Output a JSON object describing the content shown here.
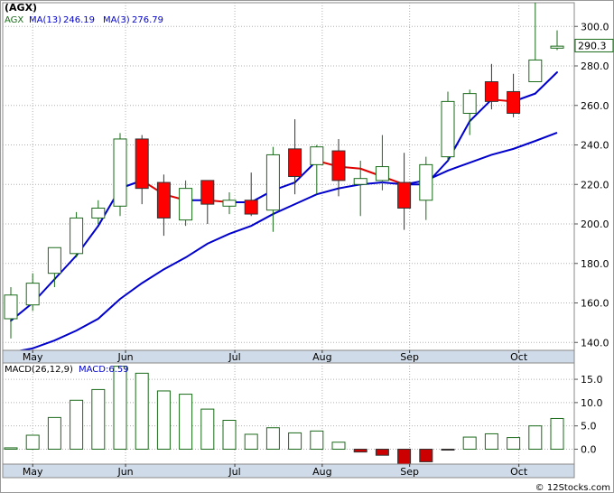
{
  "header": {
    "symbol": "(AGX)",
    "legend_ticker": "AGX",
    "ma_long_label": "MA(13)",
    "ma_long_value": "246.19",
    "ma_short_label": "MA(3)",
    "ma_short_value": "276.79",
    "last_price_tag": "290.3"
  },
  "macd_header": {
    "label": "MACD(26,12,9)",
    "value_label": "MACD:6.59"
  },
  "watermark": "© 12Stocks.com",
  "colors": {
    "background": "#ffffff",
    "panel_bg": "#ffffff",
    "grid": "#b0b0b0",
    "axis_band": "#cfdbe8",
    "up_candle_fill": "#ffffff",
    "up_candle_stroke": "#1a6b1a",
    "down_candle_fill": "#ff0000",
    "down_candle_stroke": "#333333",
    "ma_long": "#0000cc",
    "ma_short_up": "#0000cc",
    "ma_short_down": "#e00000",
    "legend_ticker": "#1a6b1a",
    "legend_ma": "#0000cc",
    "macd_pos_stroke": "#1a6b1a",
    "macd_neg_fill": "#cc0000"
  },
  "chart_data": {
    "type": "candlestick",
    "period": "weekly",
    "x_labels": [
      {
        "label": "May",
        "index": 1
      },
      {
        "label": "Jun",
        "index": 5.25
      },
      {
        "label": "Jul",
        "index": 10.25
      },
      {
        "label": "Aug",
        "index": 14.25
      },
      {
        "label": "Sep",
        "index": 18.25
      },
      {
        "label": "Oct",
        "index": 23.25
      }
    ],
    "price_axis": {
      "ylim": [
        136,
        312
      ],
      "ticks": [
        140,
        160,
        180,
        200,
        220,
        240,
        260,
        280,
        300
      ],
      "tick_labels": [
        "140.0",
        "160.0",
        "180.0",
        "200.0",
        "220.0",
        "240.0",
        "260.0",
        "280.0",
        "300.0"
      ],
      "last_price": 290.3
    },
    "candles": [
      {
        "o": 152,
        "h": 168,
        "l": 142,
        "c": 164
      },
      {
        "o": 159,
        "h": 175,
        "l": 156,
        "c": 170
      },
      {
        "o": 175,
        "h": 188,
        "l": 168,
        "c": 188
      },
      {
        "o": 185,
        "h": 206,
        "l": 183,
        "c": 203
      },
      {
        "o": 203,
        "h": 212,
        "l": 200,
        "c": 208
      },
      {
        "o": 209,
        "h": 246,
        "l": 204,
        "c": 243
      },
      {
        "o": 243,
        "h": 245,
        "l": 210,
        "c": 218
      },
      {
        "o": 221,
        "h": 225,
        "l": 194,
        "c": 203
      },
      {
        "o": 202,
        "h": 222,
        "l": 199,
        "c": 218
      },
      {
        "o": 222,
        "h": 222,
        "l": 200,
        "c": 210
      },
      {
        "o": 209,
        "h": 216,
        "l": 205,
        "c": 212
      },
      {
        "o": 212,
        "h": 226,
        "l": 204,
        "c": 205
      },
      {
        "o": 207,
        "h": 239,
        "l": 196,
        "c": 235
      },
      {
        "o": 238,
        "h": 253,
        "l": 215,
        "c": 224
      },
      {
        "o": 230,
        "h": 240,
        "l": 215,
        "c": 239
      },
      {
        "o": 237,
        "h": 243,
        "l": 214,
        "c": 222
      },
      {
        "o": 220,
        "h": 232,
        "l": 204,
        "c": 223
      },
      {
        "o": 222,
        "h": 245,
        "l": 217,
        "c": 229
      },
      {
        "o": 221,
        "h": 236,
        "l": 197,
        "c": 208
      },
      {
        "o": 212,
        "h": 234,
        "l": 202,
        "c": 230
      },
      {
        "o": 234,
        "h": 267,
        "l": 232,
        "c": 262
      },
      {
        "o": 256,
        "h": 268,
        "l": 245,
        "c": 266
      },
      {
        "o": 272,
        "h": 281,
        "l": 258,
        "c": 262
      },
      {
        "o": 267,
        "h": 276,
        "l": 254,
        "c": 256
      },
      {
        "o": 272,
        "h": 312,
        "l": 272,
        "c": 283
      },
      {
        "o": 289,
        "h": 298,
        "l": 288,
        "c": 290
      }
    ],
    "series": [
      {
        "name": "MA(13)",
        "values": [
          null,
          null,
          null,
          null,
          null,
          null,
          null,
          null,
          null,
          null,
          null,
          null,
          null,
          null,
          null,
          null,
          null,
          null,
          null,
          null,
          null,
          null,
          null,
          null,
          null,
          null
        ]
      }
    ],
    "ma_long": [
      135,
      137,
      141,
      146,
      152,
      162,
      170,
      177,
      183,
      190,
      195,
      199,
      205,
      210,
      215,
      218,
      220,
      221,
      220,
      222,
      227,
      231,
      235,
      238,
      242,
      246.19
    ],
    "ma_short": [
      151,
      160,
      172,
      184,
      199,
      218,
      222,
      215,
      212,
      212,
      211,
      211,
      217,
      221,
      232,
      229,
      228,
      224,
      220,
      220,
      232,
      252,
      263,
      262,
      266,
      276.79
    ],
    "macd": {
      "label": "MACD(26,12,9)",
      "ylim": [
        -3.2,
        18.5
      ],
      "ticks": [
        0,
        5,
        10,
        15
      ],
      "tick_labels": [
        "0.0",
        "5.0",
        "10.0",
        "15.0"
      ],
      "values": [
        0.3,
        3.0,
        6.8,
        10.5,
        12.8,
        17.8,
        16.3,
        12.5,
        11.8,
        8.6,
        6.2,
        3.2,
        4.6,
        3.5,
        3.9,
        1.5,
        -0.6,
        -1.3,
        -3.2,
        -2.7,
        -0.2,
        2.6,
        3.3,
        2.5,
        5.0,
        6.59
      ]
    }
  }
}
